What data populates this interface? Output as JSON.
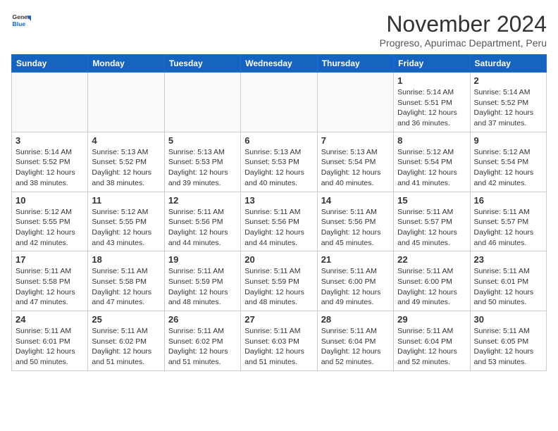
{
  "header": {
    "logo_general": "General",
    "logo_blue": "Blue",
    "month_title": "November 2024",
    "subtitle": "Progreso, Apurimac Department, Peru"
  },
  "days_of_week": [
    "Sunday",
    "Monday",
    "Tuesday",
    "Wednesday",
    "Thursday",
    "Friday",
    "Saturday"
  ],
  "weeks": [
    [
      {
        "day": "",
        "info": ""
      },
      {
        "day": "",
        "info": ""
      },
      {
        "day": "",
        "info": ""
      },
      {
        "day": "",
        "info": ""
      },
      {
        "day": "",
        "info": ""
      },
      {
        "day": "1",
        "info": "Sunrise: 5:14 AM\nSunset: 5:51 PM\nDaylight: 12 hours\nand 36 minutes."
      },
      {
        "day": "2",
        "info": "Sunrise: 5:14 AM\nSunset: 5:52 PM\nDaylight: 12 hours\nand 37 minutes."
      }
    ],
    [
      {
        "day": "3",
        "info": "Sunrise: 5:14 AM\nSunset: 5:52 PM\nDaylight: 12 hours\nand 38 minutes."
      },
      {
        "day": "4",
        "info": "Sunrise: 5:13 AM\nSunset: 5:52 PM\nDaylight: 12 hours\nand 38 minutes."
      },
      {
        "day": "5",
        "info": "Sunrise: 5:13 AM\nSunset: 5:53 PM\nDaylight: 12 hours\nand 39 minutes."
      },
      {
        "day": "6",
        "info": "Sunrise: 5:13 AM\nSunset: 5:53 PM\nDaylight: 12 hours\nand 40 minutes."
      },
      {
        "day": "7",
        "info": "Sunrise: 5:13 AM\nSunset: 5:54 PM\nDaylight: 12 hours\nand 40 minutes."
      },
      {
        "day": "8",
        "info": "Sunrise: 5:12 AM\nSunset: 5:54 PM\nDaylight: 12 hours\nand 41 minutes."
      },
      {
        "day": "9",
        "info": "Sunrise: 5:12 AM\nSunset: 5:54 PM\nDaylight: 12 hours\nand 42 minutes."
      }
    ],
    [
      {
        "day": "10",
        "info": "Sunrise: 5:12 AM\nSunset: 5:55 PM\nDaylight: 12 hours\nand 42 minutes."
      },
      {
        "day": "11",
        "info": "Sunrise: 5:12 AM\nSunset: 5:55 PM\nDaylight: 12 hours\nand 43 minutes."
      },
      {
        "day": "12",
        "info": "Sunrise: 5:11 AM\nSunset: 5:56 PM\nDaylight: 12 hours\nand 44 minutes."
      },
      {
        "day": "13",
        "info": "Sunrise: 5:11 AM\nSunset: 5:56 PM\nDaylight: 12 hours\nand 44 minutes."
      },
      {
        "day": "14",
        "info": "Sunrise: 5:11 AM\nSunset: 5:56 PM\nDaylight: 12 hours\nand 45 minutes."
      },
      {
        "day": "15",
        "info": "Sunrise: 5:11 AM\nSunset: 5:57 PM\nDaylight: 12 hours\nand 45 minutes."
      },
      {
        "day": "16",
        "info": "Sunrise: 5:11 AM\nSunset: 5:57 PM\nDaylight: 12 hours\nand 46 minutes."
      }
    ],
    [
      {
        "day": "17",
        "info": "Sunrise: 5:11 AM\nSunset: 5:58 PM\nDaylight: 12 hours\nand 47 minutes."
      },
      {
        "day": "18",
        "info": "Sunrise: 5:11 AM\nSunset: 5:58 PM\nDaylight: 12 hours\nand 47 minutes."
      },
      {
        "day": "19",
        "info": "Sunrise: 5:11 AM\nSunset: 5:59 PM\nDaylight: 12 hours\nand 48 minutes."
      },
      {
        "day": "20",
        "info": "Sunrise: 5:11 AM\nSunset: 5:59 PM\nDaylight: 12 hours\nand 48 minutes."
      },
      {
        "day": "21",
        "info": "Sunrise: 5:11 AM\nSunset: 6:00 PM\nDaylight: 12 hours\nand 49 minutes."
      },
      {
        "day": "22",
        "info": "Sunrise: 5:11 AM\nSunset: 6:00 PM\nDaylight: 12 hours\nand 49 minutes."
      },
      {
        "day": "23",
        "info": "Sunrise: 5:11 AM\nSunset: 6:01 PM\nDaylight: 12 hours\nand 50 minutes."
      }
    ],
    [
      {
        "day": "24",
        "info": "Sunrise: 5:11 AM\nSunset: 6:01 PM\nDaylight: 12 hours\nand 50 minutes."
      },
      {
        "day": "25",
        "info": "Sunrise: 5:11 AM\nSunset: 6:02 PM\nDaylight: 12 hours\nand 51 minutes."
      },
      {
        "day": "26",
        "info": "Sunrise: 5:11 AM\nSunset: 6:02 PM\nDaylight: 12 hours\nand 51 minutes."
      },
      {
        "day": "27",
        "info": "Sunrise: 5:11 AM\nSunset: 6:03 PM\nDaylight: 12 hours\nand 51 minutes."
      },
      {
        "day": "28",
        "info": "Sunrise: 5:11 AM\nSunset: 6:04 PM\nDaylight: 12 hours\nand 52 minutes."
      },
      {
        "day": "29",
        "info": "Sunrise: 5:11 AM\nSunset: 6:04 PM\nDaylight: 12 hours\nand 52 minutes."
      },
      {
        "day": "30",
        "info": "Sunrise: 5:11 AM\nSunset: 6:05 PM\nDaylight: 12 hours\nand 53 minutes."
      }
    ]
  ]
}
